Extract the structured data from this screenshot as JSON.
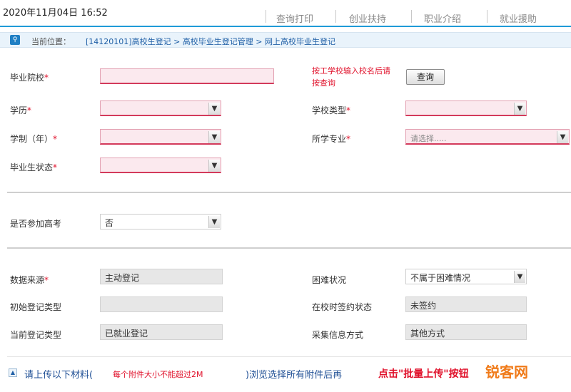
{
  "header": {
    "datetime": "2020年11月04日 16:52",
    "nav": [
      "查询打印",
      "创业扶持",
      "职业介绍",
      "就业援助"
    ]
  },
  "breadcrumb": {
    "label": "当前位置：",
    "path": "[14120101]高校生登记 > 高校毕业生登记管理 > 网上高校毕业生登记"
  },
  "form": {
    "school_label": "毕业院校",
    "school_value": "",
    "school_hint": "按工学校输入校名后请按查询",
    "query_button": "查询",
    "education_label": "学历",
    "education_value": "",
    "school_type_label": "学校类型",
    "school_type_value": "",
    "duration_label": "学制（年）",
    "duration_value": "",
    "major_label": "所学专业",
    "major_placeholder": "请选择.....",
    "grad_status_label": "毕业生状态",
    "grad_status_value": "",
    "exam_label": "是否参加高考",
    "exam_value": "否",
    "source_label": "数据来源",
    "source_value": "主动登记",
    "difficulty_label": "困难状况",
    "difficulty_value": "不属于困难情况",
    "initial_type_label": "初始登记类型",
    "initial_type_value": "",
    "contract_label": "在校时签约状态",
    "contract_value": "未签约",
    "current_type_label": "当前登记类型",
    "current_type_value": "已就业登记",
    "collect_label": "采集信息方式",
    "collect_value": "其他方式",
    "required_mark": "*"
  },
  "upload": {
    "text1": "请上传以下材料(",
    "text2": "每个附件大小不能超过2M",
    "text3": ")浏览选择所有附件后再",
    "text4": "点击\"批量上传\"按钮"
  },
  "watermark": "锐客网",
  "colors": {
    "accent": "#1f9bd7",
    "required": "#e0102a",
    "link": "#1f5fa6"
  }
}
